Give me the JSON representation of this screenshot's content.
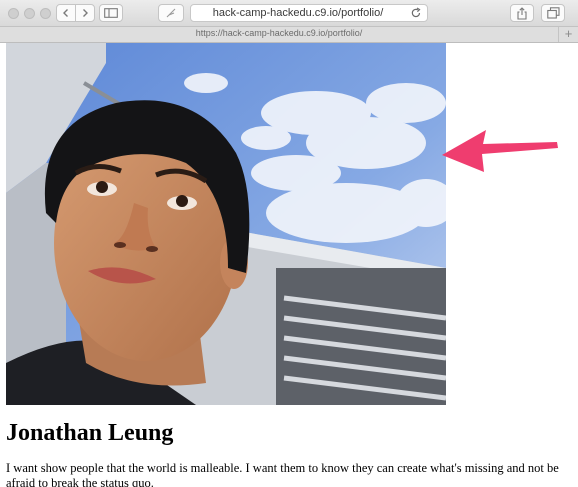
{
  "browser": {
    "address_bar_text": "hack-camp-hackedu.c9.io/portfolio/",
    "tab_url": "https://hack-camp-hackedu.c9.io/portfolio/",
    "new_tab_label": "+"
  },
  "profile": {
    "name": "Jonathan Leung",
    "bio": "I want show people that the world is malleable. I want them to know they can create what's missing and not be afraid to break the status quo."
  },
  "icons": {
    "back": "chevron-left-icon",
    "forward": "chevron-right-icon",
    "sidebar": "sidebar-icon",
    "bookmark": "feather-icon",
    "reload": "reload-icon",
    "share": "share-icon",
    "tabs": "tab-overview-icon"
  },
  "colors": {
    "annotation_arrow": "#ef3d6f",
    "sky": "#6f95d9"
  }
}
